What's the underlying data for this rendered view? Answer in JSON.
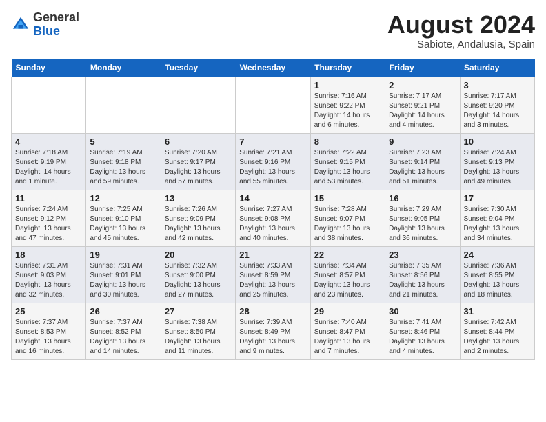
{
  "logo": {
    "line1": "General",
    "line2": "Blue"
  },
  "title": {
    "month_year": "August 2024",
    "location": "Sabiote, Andalusia, Spain"
  },
  "weekdays": [
    "Sunday",
    "Monday",
    "Tuesday",
    "Wednesday",
    "Thursday",
    "Friday",
    "Saturday"
  ],
  "weeks": [
    [
      {
        "day": "",
        "sunrise": "",
        "sunset": "",
        "daylight": ""
      },
      {
        "day": "",
        "sunrise": "",
        "sunset": "",
        "daylight": ""
      },
      {
        "day": "",
        "sunrise": "",
        "sunset": "",
        "daylight": ""
      },
      {
        "day": "",
        "sunrise": "",
        "sunset": "",
        "daylight": ""
      },
      {
        "day": "1",
        "sunrise": "Sunrise: 7:16 AM",
        "sunset": "Sunset: 9:22 PM",
        "daylight": "Daylight: 14 hours and 6 minutes."
      },
      {
        "day": "2",
        "sunrise": "Sunrise: 7:17 AM",
        "sunset": "Sunset: 9:21 PM",
        "daylight": "Daylight: 14 hours and 4 minutes."
      },
      {
        "day": "3",
        "sunrise": "Sunrise: 7:17 AM",
        "sunset": "Sunset: 9:20 PM",
        "daylight": "Daylight: 14 hours and 3 minutes."
      }
    ],
    [
      {
        "day": "4",
        "sunrise": "Sunrise: 7:18 AM",
        "sunset": "Sunset: 9:19 PM",
        "daylight": "Daylight: 14 hours and 1 minute."
      },
      {
        "day": "5",
        "sunrise": "Sunrise: 7:19 AM",
        "sunset": "Sunset: 9:18 PM",
        "daylight": "Daylight: 13 hours and 59 minutes."
      },
      {
        "day": "6",
        "sunrise": "Sunrise: 7:20 AM",
        "sunset": "Sunset: 9:17 PM",
        "daylight": "Daylight: 13 hours and 57 minutes."
      },
      {
        "day": "7",
        "sunrise": "Sunrise: 7:21 AM",
        "sunset": "Sunset: 9:16 PM",
        "daylight": "Daylight: 13 hours and 55 minutes."
      },
      {
        "day": "8",
        "sunrise": "Sunrise: 7:22 AM",
        "sunset": "Sunset: 9:15 PM",
        "daylight": "Daylight: 13 hours and 53 minutes."
      },
      {
        "day": "9",
        "sunrise": "Sunrise: 7:23 AM",
        "sunset": "Sunset: 9:14 PM",
        "daylight": "Daylight: 13 hours and 51 minutes."
      },
      {
        "day": "10",
        "sunrise": "Sunrise: 7:24 AM",
        "sunset": "Sunset: 9:13 PM",
        "daylight": "Daylight: 13 hours and 49 minutes."
      }
    ],
    [
      {
        "day": "11",
        "sunrise": "Sunrise: 7:24 AM",
        "sunset": "Sunset: 9:12 PM",
        "daylight": "Daylight: 13 hours and 47 minutes."
      },
      {
        "day": "12",
        "sunrise": "Sunrise: 7:25 AM",
        "sunset": "Sunset: 9:10 PM",
        "daylight": "Daylight: 13 hours and 45 minutes."
      },
      {
        "day": "13",
        "sunrise": "Sunrise: 7:26 AM",
        "sunset": "Sunset: 9:09 PM",
        "daylight": "Daylight: 13 hours and 42 minutes."
      },
      {
        "day": "14",
        "sunrise": "Sunrise: 7:27 AM",
        "sunset": "Sunset: 9:08 PM",
        "daylight": "Daylight: 13 hours and 40 minutes."
      },
      {
        "day": "15",
        "sunrise": "Sunrise: 7:28 AM",
        "sunset": "Sunset: 9:07 PM",
        "daylight": "Daylight: 13 hours and 38 minutes."
      },
      {
        "day": "16",
        "sunrise": "Sunrise: 7:29 AM",
        "sunset": "Sunset: 9:05 PM",
        "daylight": "Daylight: 13 hours and 36 minutes."
      },
      {
        "day": "17",
        "sunrise": "Sunrise: 7:30 AM",
        "sunset": "Sunset: 9:04 PM",
        "daylight": "Daylight: 13 hours and 34 minutes."
      }
    ],
    [
      {
        "day": "18",
        "sunrise": "Sunrise: 7:31 AM",
        "sunset": "Sunset: 9:03 PM",
        "daylight": "Daylight: 13 hours and 32 minutes."
      },
      {
        "day": "19",
        "sunrise": "Sunrise: 7:31 AM",
        "sunset": "Sunset: 9:01 PM",
        "daylight": "Daylight: 13 hours and 30 minutes."
      },
      {
        "day": "20",
        "sunrise": "Sunrise: 7:32 AM",
        "sunset": "Sunset: 9:00 PM",
        "daylight": "Daylight: 13 hours and 27 minutes."
      },
      {
        "day": "21",
        "sunrise": "Sunrise: 7:33 AM",
        "sunset": "Sunset: 8:59 PM",
        "daylight": "Daylight: 13 hours and 25 minutes."
      },
      {
        "day": "22",
        "sunrise": "Sunrise: 7:34 AM",
        "sunset": "Sunset: 8:57 PM",
        "daylight": "Daylight: 13 hours and 23 minutes."
      },
      {
        "day": "23",
        "sunrise": "Sunrise: 7:35 AM",
        "sunset": "Sunset: 8:56 PM",
        "daylight": "Daylight: 13 hours and 21 minutes."
      },
      {
        "day": "24",
        "sunrise": "Sunrise: 7:36 AM",
        "sunset": "Sunset: 8:55 PM",
        "daylight": "Daylight: 13 hours and 18 minutes."
      }
    ],
    [
      {
        "day": "25",
        "sunrise": "Sunrise: 7:37 AM",
        "sunset": "Sunset: 8:53 PM",
        "daylight": "Daylight: 13 hours and 16 minutes."
      },
      {
        "day": "26",
        "sunrise": "Sunrise: 7:37 AM",
        "sunset": "Sunset: 8:52 PM",
        "daylight": "Daylight: 13 hours and 14 minutes."
      },
      {
        "day": "27",
        "sunrise": "Sunrise: 7:38 AM",
        "sunset": "Sunset: 8:50 PM",
        "daylight": "Daylight: 13 hours and 11 minutes."
      },
      {
        "day": "28",
        "sunrise": "Sunrise: 7:39 AM",
        "sunset": "Sunset: 8:49 PM",
        "daylight": "Daylight: 13 hours and 9 minutes."
      },
      {
        "day": "29",
        "sunrise": "Sunrise: 7:40 AM",
        "sunset": "Sunset: 8:47 PM",
        "daylight": "Daylight: 13 hours and 7 minutes."
      },
      {
        "day": "30",
        "sunrise": "Sunrise: 7:41 AM",
        "sunset": "Sunset: 8:46 PM",
        "daylight": "Daylight: 13 hours and 4 minutes."
      },
      {
        "day": "31",
        "sunrise": "Sunrise: 7:42 AM",
        "sunset": "Sunset: 8:44 PM",
        "daylight": "Daylight: 13 hours and 2 minutes."
      }
    ]
  ]
}
